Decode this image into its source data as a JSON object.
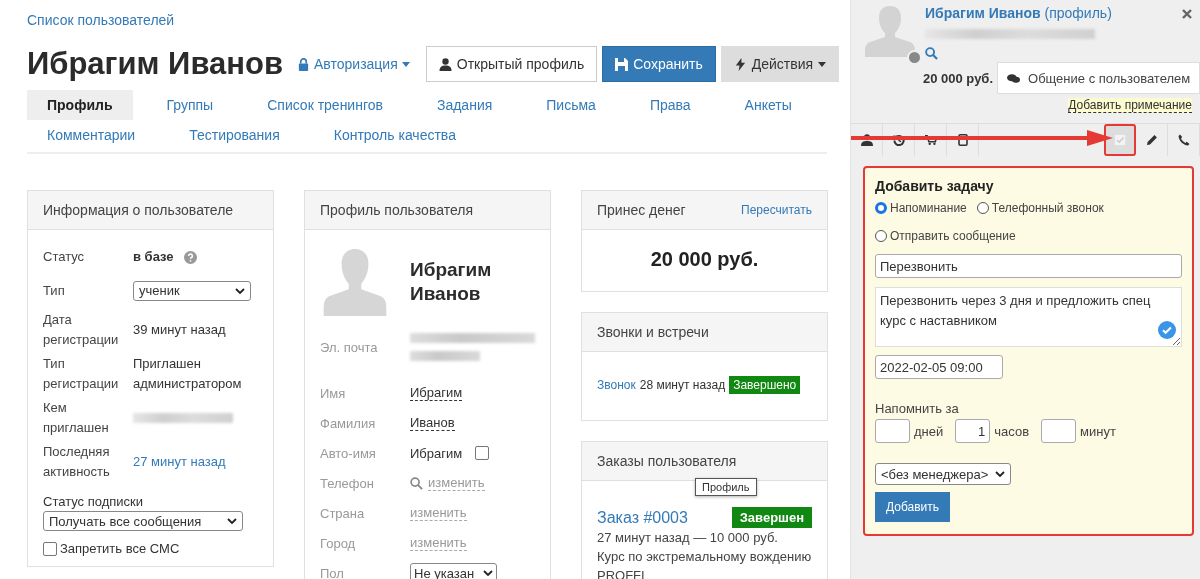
{
  "breadcrumb": "Список пользователей",
  "title": "Ибрагим Иванов",
  "auth_link": "Авторизация",
  "buttons": [
    {
      "label": "Открытый профиль",
      "kind": "default"
    },
    {
      "label": "Сохранить",
      "kind": "primary"
    },
    {
      "label": "Действия",
      "kind": "dropdown"
    }
  ],
  "tabs": [
    {
      "label": "Профиль",
      "selected": true
    },
    {
      "label": "Группы",
      "selected": false
    },
    {
      "label": "Список тренингов",
      "selected": false
    },
    {
      "label": "Задания",
      "selected": false
    },
    {
      "label": "Письма",
      "selected": false
    },
    {
      "label": "Права",
      "selected": false
    },
    {
      "label": "Анкеты",
      "selected": false
    },
    {
      "label": "Комментарии",
      "selected": false
    },
    {
      "label": "Тестирования",
      "selected": false
    },
    {
      "label": "Контроль качества",
      "selected": false
    }
  ],
  "user_info": {
    "title": "Информация о пользователе",
    "rows": [
      {
        "label": "Статус",
        "value": "в базе",
        "kind": "status"
      },
      {
        "label": "Тип",
        "value": "ученик",
        "kind": "select"
      },
      {
        "label": "Дата регистрации",
        "value": "39 минут назад",
        "kind": "text"
      },
      {
        "label": "Тип регистрации",
        "value": "Приглашен администратором",
        "kind": "text"
      },
      {
        "label": "Кем приглашен",
        "kind": "blurred"
      },
      {
        "label": "Последняя активность",
        "value": "27 минут назад",
        "kind": "link"
      }
    ],
    "subscription_label": "Статус подписки",
    "subscription_value": "Получать все сообщения",
    "sms": {
      "label": "Запретить все СМС",
      "checked": false
    }
  },
  "profile": {
    "title": "Профиль пользователя",
    "name": "Ибрагим Иванов",
    "fields": [
      {
        "label": "Эл. почта",
        "kind": "blurred"
      },
      {
        "label": "Имя",
        "value": "Ибрагим",
        "kind": "editable"
      },
      {
        "label": "Фамилия",
        "value": "Иванов",
        "kind": "editable"
      },
      {
        "label": "Авто-имя",
        "value": "Ибрагим",
        "kind": "checkbox",
        "checked": false
      },
      {
        "label": "Телефон",
        "value": "изменить",
        "kind": "search_link"
      },
      {
        "label": "Страна",
        "value": "изменить",
        "kind": "link"
      },
      {
        "label": "Город",
        "value": "изменить",
        "kind": "link"
      },
      {
        "label": "Пол",
        "value": "Не указан",
        "kind": "select"
      }
    ]
  },
  "money": {
    "title": "Принес денег",
    "action": "Пересчитать",
    "amount": "20 000 руб."
  },
  "calls": {
    "title": "Звонки и встречи",
    "items": [
      {
        "link": "Звонок",
        "time": "28 минут назад",
        "status": "Завершено"
      }
    ]
  },
  "orders": {
    "title": "Заказы пользователя",
    "items": [
      {
        "link": "Заказ #0003",
        "status": "Завершен",
        "meta": "27 минут назад — 10 000 руб.",
        "product": "Курс по экстремальному вождению PROFFI"
      }
    ]
  },
  "tooltip": "Профиль",
  "side": {
    "name": "Ибрагим Иванов",
    "profile_link": "(профиль)",
    "amount": "20 000 руб.",
    "chat_button": "Общение с пользователем",
    "note_link": "Добавить примечание",
    "toolbar": [
      {
        "kind": "person",
        "selected": false
      },
      {
        "kind": "history",
        "selected": false
      },
      {
        "kind": "cart",
        "selected": false
      },
      {
        "kind": "tablet",
        "selected": false
      },
      {
        "kind": "task",
        "selected": true
      },
      {
        "kind": "pencil",
        "selected": false
      },
      {
        "kind": "phone",
        "selected": false
      }
    ]
  },
  "task_form": {
    "title": "Добавить задачу",
    "types": [
      {
        "label": "Напоминание",
        "selected": true
      },
      {
        "label": "Телефонный звонок",
        "selected": false
      },
      {
        "label": "Отправить сообщение",
        "selected": false
      }
    ],
    "subject": "Перезвонить",
    "description": "Перезвонить через 3 дня и предложить спец курс с наставником",
    "datetime": "2022-02-05 09:00",
    "remind_label": "Напомнить за",
    "remind": [
      {
        "unit": "дней"
      },
      {
        "value": "1",
        "unit": "часов"
      },
      {
        "unit": "минут"
      }
    ],
    "manager": "<без менеджера>",
    "submit": "Добавить"
  }
}
